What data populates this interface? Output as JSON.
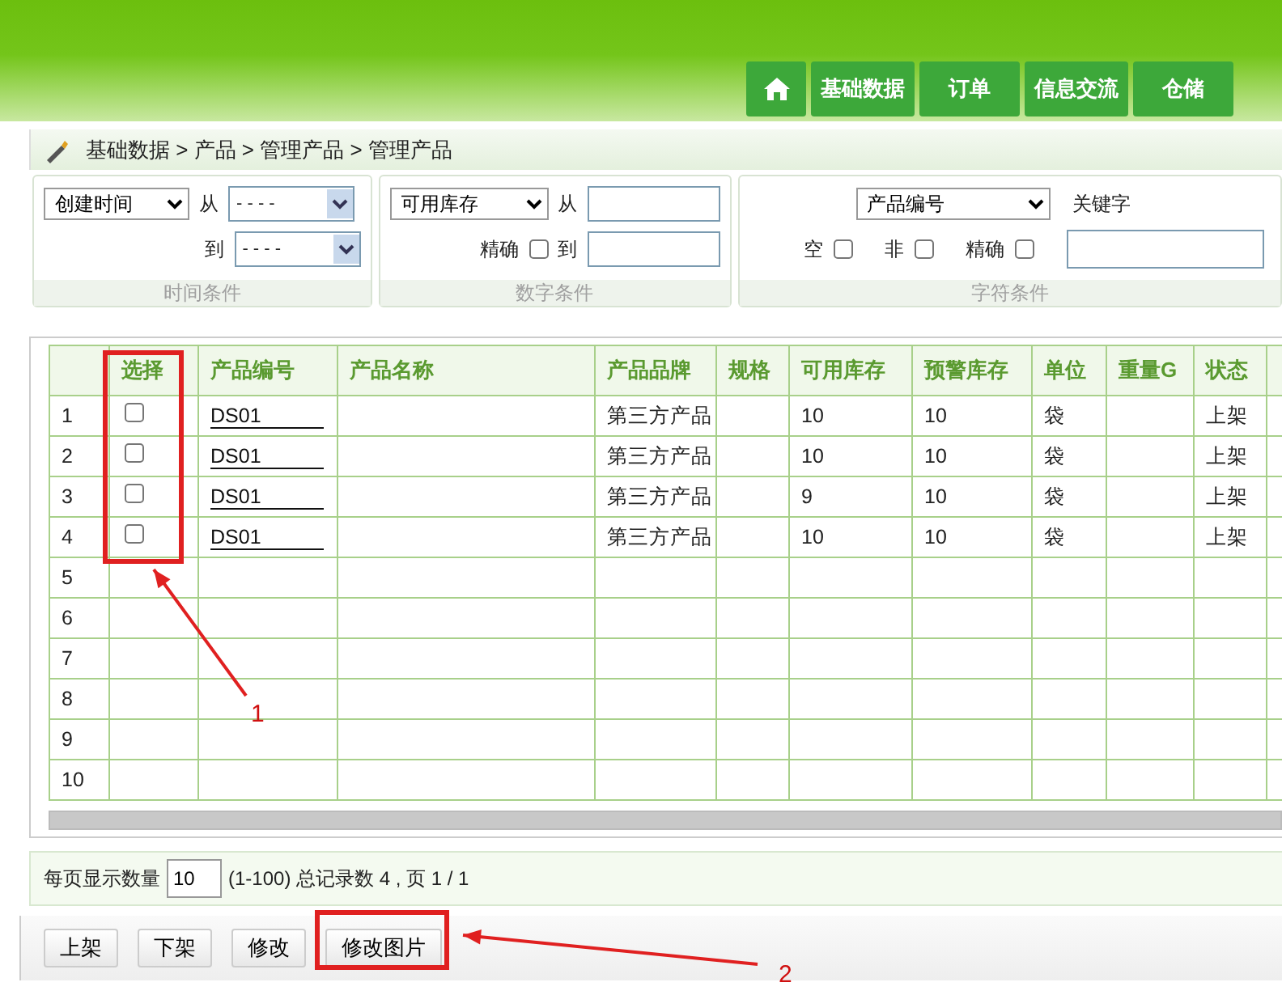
{
  "nav_buttons": [
    "基础数据",
    "订单",
    "信息交流",
    "仓储"
  ],
  "breadcrumb": "基础数据 > 产品 > 管理产品 > 管理产品",
  "time_filter": {
    "field": "创建时间",
    "from_label": "从",
    "from_value": "- - - -",
    "to_label": "到",
    "to_value": "- - - -",
    "caption": "时间条件"
  },
  "number_filter": {
    "field": "可用库存",
    "from_label": "从",
    "exact_label": "精确",
    "exact_checked": false,
    "to_label": "到",
    "caption": "数字条件"
  },
  "text_filter": {
    "field": "产品编号",
    "keyword_label": "关键字",
    "options": [
      {
        "label": "空",
        "checked": false
      },
      {
        "label": "非",
        "checked": false
      },
      {
        "label": "精确",
        "checked": false
      }
    ],
    "caption": "字符条件"
  },
  "table": {
    "columns": [
      "选择",
      "产品编号",
      "产品名称",
      "产品品牌",
      "规格",
      "可用库存",
      "预警库存",
      "单位",
      "重量G",
      "状态"
    ],
    "rows": [
      {
        "index": "1",
        "selected": false,
        "code": "DS01",
        "brand": "第三方产品",
        "stock": "10",
        "warning": "10",
        "unit": "袋",
        "status": "上架"
      },
      {
        "index": "2",
        "selected": false,
        "code": "DS01",
        "brand": "第三方产品",
        "stock": "10",
        "warning": "10",
        "unit": "袋",
        "status": "上架"
      },
      {
        "index": "3",
        "selected": false,
        "code": "DS01",
        "brand": "第三方产品",
        "stock": "9",
        "warning": "10",
        "unit": "袋",
        "status": "上架"
      },
      {
        "index": "4",
        "selected": false,
        "code": "DS01",
        "brand": "第三方产品",
        "stock": "10",
        "warning": "10",
        "unit": "袋",
        "status": "上架"
      }
    ],
    "empty_rows": [
      "5",
      "6",
      "7",
      "8",
      "9",
      "10"
    ]
  },
  "pagination": {
    "label": "每页显示数量",
    "page_size": "10",
    "info": "(1-100) 总记录数 4 , 页 1 / 1"
  },
  "buttons": [
    "上架",
    "下架",
    "修改",
    "修改图片"
  ],
  "annotations": [
    {
      "label": "1"
    },
    {
      "label": "2"
    }
  ]
}
